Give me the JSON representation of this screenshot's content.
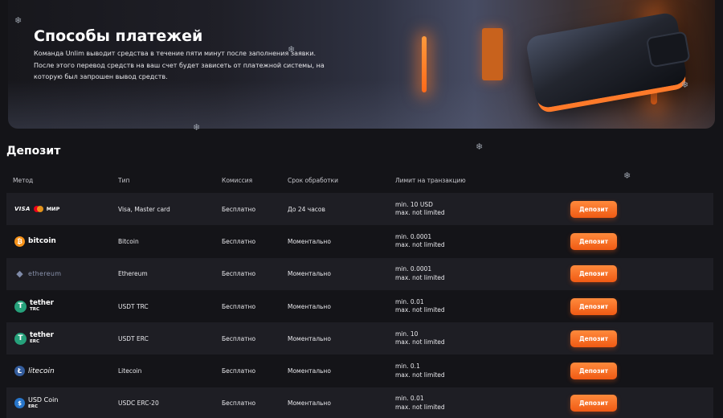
{
  "banner": {
    "title": "Способы платежей",
    "text": "Команда Unlim выводит средства в течение пяти минут после заполнения заявки. После этого перевод средств на ваш счет будет зависеть от платежной системы, на которую был запрошен вывод средств."
  },
  "deposit": {
    "title": "Депозит",
    "headers": {
      "method": "Метод",
      "type": "Тип",
      "fee": "Комиссия",
      "time": "Срок обработки",
      "limit": "Лимит на транзакцию"
    },
    "rows": [
      {
        "logo": {
          "visa": "VISA",
          "mir": "МИР"
        },
        "type": "Visa, Master card",
        "fee": "Бесплатно",
        "time": "До 24 часов",
        "min": "min. 10 USD",
        "max": "max. not limited",
        "button": "Депозит"
      },
      {
        "logo": {
          "symbol": "₿",
          "text": "bitcoin"
        },
        "type": "Bitcoin",
        "fee": "Бесплатно",
        "time": "Моментально",
        "min": "min. 0.0001",
        "max": "max. not limited",
        "button": "Депозит"
      },
      {
        "logo": {
          "symbol": "◆",
          "text": "ethereum"
        },
        "type": "Ethereum",
        "fee": "Бесплатно",
        "time": "Моментально",
        "min": "min. 0.0001",
        "max": "max. not limited",
        "button": "Депозит"
      },
      {
        "logo": {
          "symbol": "T",
          "text": "tether",
          "sub": "TRC"
        },
        "type": "USDT TRC",
        "fee": "Бесплатно",
        "time": "Моментально",
        "min": "min. 0.01",
        "max": "max. not limited",
        "button": "Депозит"
      },
      {
        "logo": {
          "symbol": "T",
          "text": "tether",
          "sub": "ERC"
        },
        "type": "USDT ERC",
        "fee": "Бесплатно",
        "time": "Моментально",
        "min": "min. 10",
        "max": "max. not limited",
        "button": "Депозит"
      },
      {
        "logo": {
          "symbol": "Ł",
          "text": "litecoin"
        },
        "type": "Litecoin",
        "fee": "Бесплатно",
        "time": "Моментально",
        "min": "min. 0.1",
        "max": "max. not limited",
        "button": "Депозит"
      },
      {
        "logo": {
          "symbol": "$",
          "text": "USD Coin",
          "sub": "ERC"
        },
        "type": "USDC ERC-20",
        "fee": "Бесплатно",
        "time": "Моментально",
        "min": "min. 0.01",
        "max": "max. not limited",
        "button": "Депозит"
      }
    ]
  },
  "decor": {
    "snowflake": "❄"
  },
  "colors": {
    "accent": "#f36a1f",
    "background": "#141418",
    "row_alt": "#1e1e24"
  }
}
